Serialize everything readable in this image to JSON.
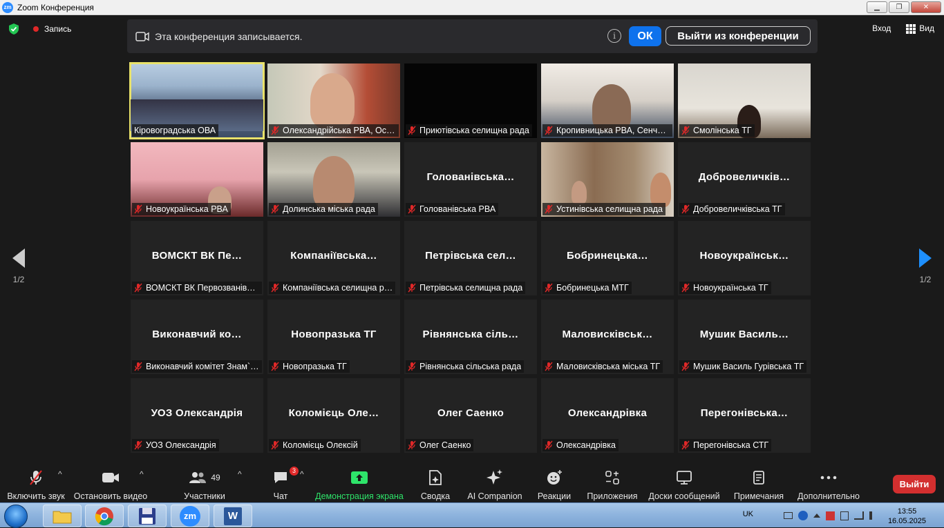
{
  "window": {
    "title": "Zoom Конференция",
    "app_icon": "zm",
    "minimize_label": "▁",
    "restore_label": "❐",
    "close_label": "✕"
  },
  "topbar": {
    "recording_label": "Запись",
    "view_label": "Вход",
    "gallery_label": "Вид"
  },
  "banner": {
    "text": "Эта конференция записывается.",
    "info": "i",
    "ok_label": "ОК",
    "leave_label": "Выйти из конференции"
  },
  "pagination": {
    "left": "1/2",
    "right": "1/2"
  },
  "tiles": [
    {
      "big": "",
      "label": "Кіровоградська ОВА",
      "muted": false,
      "video": "v-conf",
      "active": true
    },
    {
      "big": "",
      "label": "Олександрійська РВА, Ост…",
      "muted": true,
      "video": "v-woman"
    },
    {
      "big": "",
      "label": "Приютівська селищна рада",
      "muted": true,
      "video": "v-dark"
    },
    {
      "big": "",
      "label": "Кропивницька РВА, Сенче…",
      "muted": true,
      "video": "v-man1"
    },
    {
      "big": "",
      "label": "Смолінська ТГ",
      "muted": true,
      "video": "v-room"
    },
    {
      "big": "",
      "label": "Новоукраїнська РВА",
      "muted": true,
      "video": "v-pink"
    },
    {
      "big": "",
      "label": "Долинська міська рада",
      "muted": true,
      "video": "v-man2"
    },
    {
      "big": "Голованівська…",
      "label": "Голованівська РВА",
      "muted": true,
      "video": ""
    },
    {
      "big": "",
      "label": "Устинівська селищна рада",
      "muted": true,
      "video": "v-shelf"
    },
    {
      "big": "Добровеличків…",
      "label": "Добровеличківська ТГ",
      "muted": true,
      "video": ""
    },
    {
      "big": "ВОМСКТ ВК Пе…",
      "label": "ВОМСКТ ВК Первозванівс…",
      "muted": true,
      "video": ""
    },
    {
      "big": "Компаніївська…",
      "label": "Компаніївська селищна р…",
      "muted": true,
      "video": ""
    },
    {
      "big": "Петрівська сел…",
      "label": "Петрівська селищна рада",
      "muted": true,
      "video": ""
    },
    {
      "big": "Бобринецька…",
      "label": "Бобринецька МТГ",
      "muted": true,
      "video": ""
    },
    {
      "big": "Новоукраїнськ…",
      "label": "Новоукраїнська ТГ",
      "muted": true,
      "video": ""
    },
    {
      "big": "Виконавчий ко…",
      "label": "Виконавчий комітет Знам`…",
      "muted": true,
      "video": ""
    },
    {
      "big": "Новопразька ТГ",
      "label": "Новопразька ТГ",
      "muted": true,
      "video": ""
    },
    {
      "big": "Рівнянська сіль…",
      "label": "Рівнянська сільська рада",
      "muted": true,
      "video": ""
    },
    {
      "big": "Маловисківськ…",
      "label": "Маловисківська міська ТГ",
      "muted": true,
      "video": ""
    },
    {
      "big": "Мушик Василь…",
      "label": "Мушик Василь Гурівська ТГ",
      "muted": true,
      "video": ""
    },
    {
      "big": "УОЗ Олександрія",
      "label": "УОЗ Олександрія",
      "muted": true,
      "video": ""
    },
    {
      "big": "Коломієць Оле…",
      "label": "Коломієць Олексій",
      "muted": true,
      "video": ""
    },
    {
      "big": "Олег Саенко",
      "label": "Олег Саенко",
      "muted": true,
      "video": ""
    },
    {
      "big": "Олександрівка",
      "label": "Олександрівка",
      "muted": true,
      "video": ""
    },
    {
      "big": "Перегонівська…",
      "label": "Перегонівська СТГ",
      "muted": true,
      "video": ""
    }
  ],
  "toolbar": {
    "unmute": "Включить звук",
    "stop_video": "Остановить видео",
    "participants": "Участники",
    "participants_count": "49",
    "chat": "Чат",
    "chat_badge": "3",
    "share": "Демонстрация экрана",
    "summary": "Сводка",
    "ai": "AI Companion",
    "reactions": "Реакции",
    "apps": "Приложения",
    "whiteboards": "Доски сообщений",
    "notes": "Примечания",
    "more": "Дополнительно",
    "exit": "Выйти",
    "caret": "^"
  },
  "taskbar": {
    "lang": "UK",
    "time": "13:55",
    "date": "16.05.2025",
    "zoom_task": "zm",
    "word_task": "W"
  },
  "colors": {
    "accent": "#0e72ed",
    "share_green": "#2ee46a",
    "exit_red": "#d32f2f",
    "active_speaker": "#e9e26a"
  }
}
